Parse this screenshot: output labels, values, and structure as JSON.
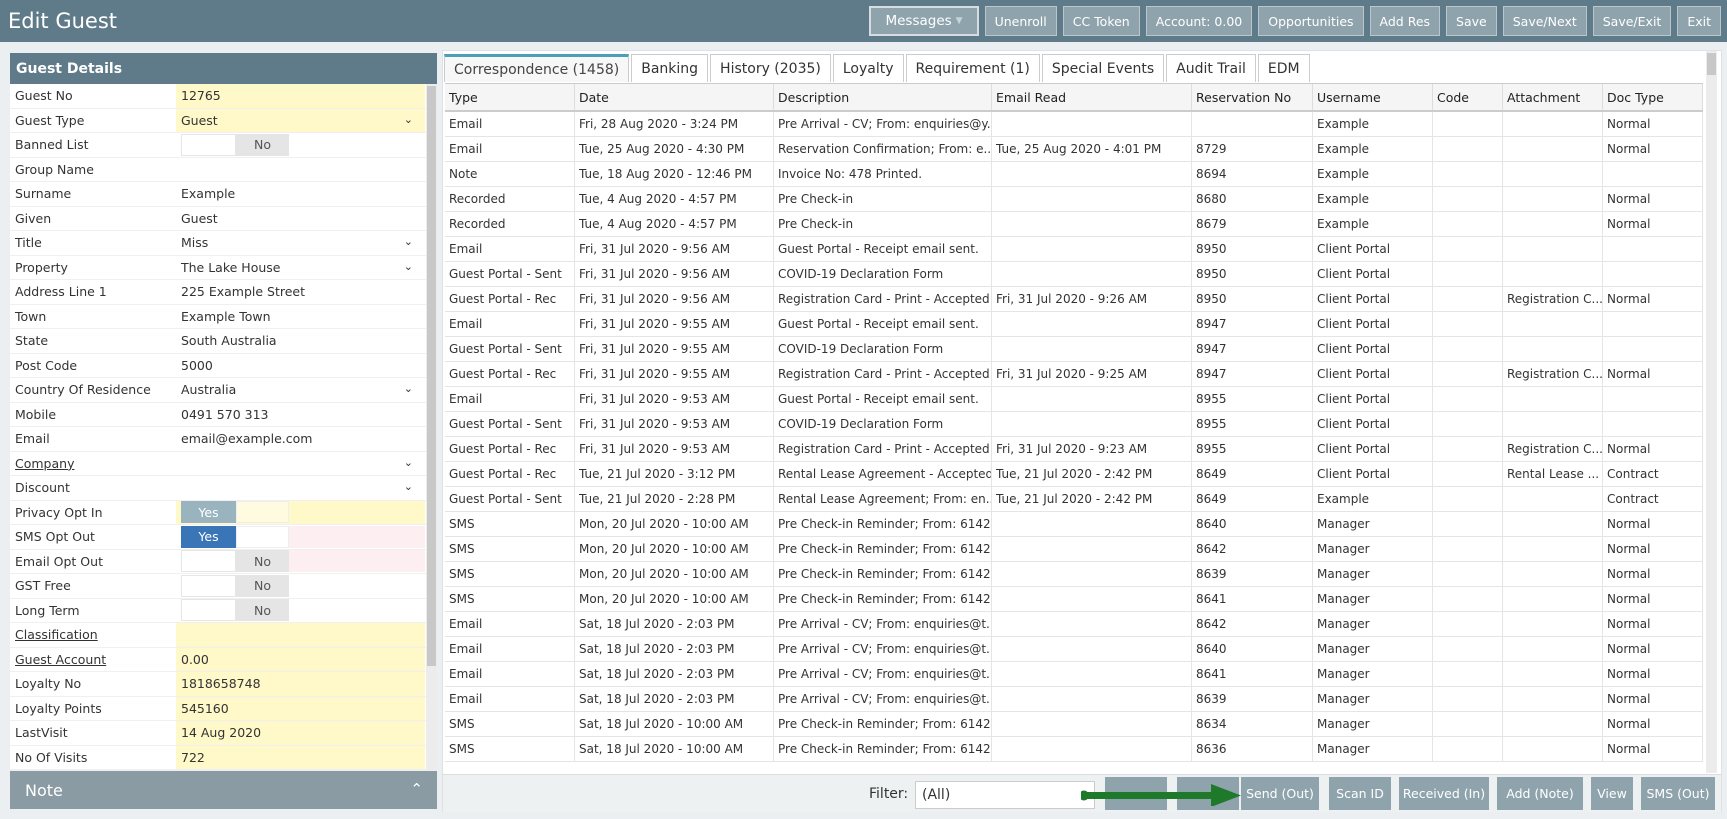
{
  "header": {
    "title": "Edit Guest",
    "buttons": [
      "Unenroll",
      "CC Token",
      "Account: 0.00",
      "Opportunities",
      "Add Res",
      "Save",
      "Save/Next",
      "Save/Exit",
      "Exit"
    ],
    "messages_label": "Messages"
  },
  "guest_details": {
    "title": "Guest Details",
    "fields": {
      "guest_no": {
        "label": "Guest No",
        "value": "12765"
      },
      "guest_type": {
        "label": "Guest Type",
        "value": "Guest"
      },
      "banned_list": {
        "label": "Banned List",
        "value": "No"
      },
      "group_name": {
        "label": "Group Name",
        "value": ""
      },
      "surname": {
        "label": "Surname",
        "value": "Example"
      },
      "given": {
        "label": "Given",
        "value": "Guest"
      },
      "title": {
        "label": "Title",
        "value": "Miss"
      },
      "property": {
        "label": "Property",
        "value": "The Lake House"
      },
      "address1": {
        "label": "Address Line 1",
        "value": "225 Example Street"
      },
      "town": {
        "label": "Town",
        "value": "Example Town"
      },
      "state": {
        "label": "State",
        "value": "South Australia"
      },
      "postcode": {
        "label": "Post Code",
        "value": "5000"
      },
      "country": {
        "label": "Country Of Residence",
        "value": "Australia"
      },
      "mobile": {
        "label": "Mobile",
        "value": "0491 570 313"
      },
      "email": {
        "label": "Email",
        "value": "email@example.com"
      },
      "company": {
        "label": "Company",
        "value": ""
      },
      "discount": {
        "label": "Discount",
        "value": ""
      },
      "privacy_opt_in": {
        "label": "Privacy Opt In",
        "value": "Yes"
      },
      "sms_opt_out": {
        "label": "SMS Opt Out",
        "value": "Yes"
      },
      "email_opt_out": {
        "label": "Email Opt Out",
        "value": "No"
      },
      "gst_free": {
        "label": "GST Free",
        "value": "No"
      },
      "long_term": {
        "label": "Long Term",
        "value": "No"
      },
      "classification": {
        "label": "Classification",
        "value": ""
      },
      "guest_account": {
        "label": "Guest Account",
        "value": "0.00"
      },
      "loyalty_no": {
        "label": "Loyalty No",
        "value": "1818658748"
      },
      "loyalty_points": {
        "label": "Loyalty Points",
        "value": "545160"
      },
      "last_visit": {
        "label": "LastVisit",
        "value": "14 Aug 2020"
      },
      "no_of_visits": {
        "label": "No Of Visits",
        "value": "722"
      }
    }
  },
  "note": {
    "label": "Note"
  },
  "tabs": [
    "Correspondence (1458)",
    "Banking",
    "History (2035)",
    "Loyalty",
    "Requirement (1)",
    "Special Events",
    "Audit Trail",
    "EDM"
  ],
  "grid": {
    "columns": [
      "Type",
      "Date",
      "Description",
      "Email Read",
      "Reservation No",
      "Username",
      "Code",
      "Attachment",
      "Doc Type"
    ],
    "rows": [
      [
        "Email",
        "Fri, 28 Aug 2020 - 3:24 PM",
        "Pre Arrival - CV; From: enquiries@y...",
        "",
        "",
        "Example",
        "",
        "",
        "Normal"
      ],
      [
        "Email",
        "Tue, 25 Aug 2020 - 4:30 PM",
        "Reservation Confirmation; From: e...",
        "Tue, 25 Aug 2020 - 4:01 PM",
        "8729",
        "Example",
        "",
        "",
        "Normal"
      ],
      [
        "Note",
        "Tue, 18 Aug 2020 - 12:46 PM",
        "Invoice No: 478 Printed.",
        "",
        "8694",
        "Example",
        "",
        "",
        ""
      ],
      [
        "Recorded",
        "Tue, 4 Aug 2020 - 4:57 PM",
        "Pre Check-in",
        "",
        "8680",
        "Example",
        "",
        "",
        "Normal"
      ],
      [
        "Recorded",
        "Tue, 4 Aug 2020 - 4:57 PM",
        "Pre Check-in",
        "",
        "8679",
        "Example",
        "",
        "",
        "Normal"
      ],
      [
        "Email",
        "Fri, 31 Jul 2020 - 9:56 AM",
        "Guest Portal - Receipt email sent.",
        "",
        "8950",
        "Client Portal",
        "",
        "",
        ""
      ],
      [
        "Guest Portal - Sent",
        "Fri, 31 Jul 2020 - 9:56 AM",
        "COVID-19 Declaration Form",
        "",
        "8950",
        "Client Portal",
        "",
        "",
        ""
      ],
      [
        "Guest Portal - Rec",
        "Fri, 31 Jul 2020 - 9:56 AM",
        "Registration Card - Print - Accepted",
        "Fri, 31 Jul 2020 - 9:26 AM",
        "8950",
        "Client Portal",
        "",
        "Registration C...",
        "Normal"
      ],
      [
        "Email",
        "Fri, 31 Jul 2020 - 9:55 AM",
        "Guest Portal - Receipt email sent.",
        "",
        "8947",
        "Client Portal",
        "",
        "",
        ""
      ],
      [
        "Guest Portal - Sent",
        "Fri, 31 Jul 2020 - 9:55 AM",
        "COVID-19 Declaration Form",
        "",
        "8947",
        "Client Portal",
        "",
        "",
        ""
      ],
      [
        "Guest Portal - Rec",
        "Fri, 31 Jul 2020 - 9:55 AM",
        "Registration Card - Print - Accepted",
        "Fri, 31 Jul 2020 - 9:25 AM",
        "8947",
        "Client Portal",
        "",
        "Registration C...",
        "Normal"
      ],
      [
        "Email",
        "Fri, 31 Jul 2020 - 9:53 AM",
        "Guest Portal - Receipt email sent.",
        "",
        "8955",
        "Client Portal",
        "",
        "",
        ""
      ],
      [
        "Guest Portal - Sent",
        "Fri, 31 Jul 2020 - 9:53 AM",
        "COVID-19 Declaration Form",
        "",
        "8955",
        "Client Portal",
        "",
        "",
        ""
      ],
      [
        "Guest Portal - Rec",
        "Fri, 31 Jul 2020 - 9:53 AM",
        "Registration Card - Print - Accepted",
        "Fri, 31 Jul 2020 - 9:23 AM",
        "8955",
        "Client Portal",
        "",
        "Registration C...",
        "Normal"
      ],
      [
        "Guest Portal - Rec",
        "Tue, 21 Jul 2020 - 3:12 PM",
        "Rental Lease Agreement - Accepted",
        "Tue, 21 Jul 2020 - 2:42 PM",
        "8649",
        "Client Portal",
        "",
        "Rental Lease ...",
        "Contract"
      ],
      [
        "Guest Portal - Sent",
        "Tue, 21 Jul 2020 - 2:28 PM",
        "Rental Lease Agreement; From: en...",
        "Tue, 21 Jul 2020 - 2:42 PM",
        "8649",
        "Example",
        "",
        "",
        "Contract"
      ],
      [
        "SMS",
        "Mon, 20 Jul 2020 - 10:00 AM",
        "Pre Check-in Reminder; From: 6142...",
        "",
        "8640",
        "Manager",
        "",
        "",
        "Normal"
      ],
      [
        "SMS",
        "Mon, 20 Jul 2020 - 10:00 AM",
        "Pre Check-in Reminder; From: 6142...",
        "",
        "8642",
        "Manager",
        "",
        "",
        "Normal"
      ],
      [
        "SMS",
        "Mon, 20 Jul 2020 - 10:00 AM",
        "Pre Check-in Reminder; From: 6142...",
        "",
        "8639",
        "Manager",
        "",
        "",
        "Normal"
      ],
      [
        "SMS",
        "Mon, 20 Jul 2020 - 10:00 AM",
        "Pre Check-in Reminder; From: 6142...",
        "",
        "8641",
        "Manager",
        "",
        "",
        "Normal"
      ],
      [
        "Email",
        "Sat, 18 Jul 2020 - 2:03 PM",
        "Pre Arrival - CV; From: enquiries@t...",
        "",
        "8642",
        "Manager",
        "",
        "",
        "Normal"
      ],
      [
        "Email",
        "Sat, 18 Jul 2020 - 2:03 PM",
        "Pre Arrival - CV; From: enquiries@t...",
        "",
        "8640",
        "Manager",
        "",
        "",
        "Normal"
      ],
      [
        "Email",
        "Sat, 18 Jul 2020 - 2:03 PM",
        "Pre Arrival - CV; From: enquiries@t...",
        "",
        "8641",
        "Manager",
        "",
        "",
        "Normal"
      ],
      [
        "Email",
        "Sat, 18 Jul 2020 - 2:03 PM",
        "Pre Arrival - CV; From: enquiries@t...",
        "",
        "8639",
        "Manager",
        "",
        "",
        "Normal"
      ],
      [
        "SMS",
        "Sat, 18 Jul 2020 - 10:00 AM",
        "Pre Check-in Reminder; From: 6142...",
        "",
        "8634",
        "Manager",
        "",
        "",
        "Normal"
      ],
      [
        "SMS",
        "Sat, 18 Jul 2020 - 10:00 AM",
        "Pre Check-in Reminder; From: 6142...",
        "",
        "8636",
        "Manager",
        "",
        "",
        "Normal"
      ]
    ]
  },
  "footer": {
    "filter_label": "Filter:",
    "filter_value": "(All)",
    "buttons": [
      "",
      "",
      "Send (Out)",
      "Scan ID",
      "Received (In)",
      "Add (Note)",
      "View",
      "SMS (Out)"
    ]
  },
  "colors": {
    "header": "#5f7b8a",
    "accent": "#4b9fb6",
    "yellow_field": "#fff9c9",
    "arrow": "#1e7a2a"
  }
}
